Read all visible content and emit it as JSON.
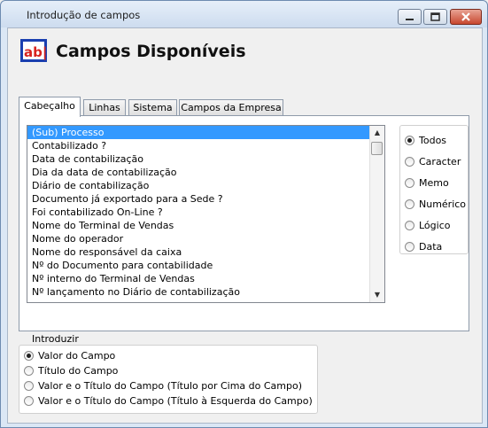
{
  "window": {
    "title": "Introdução de campos"
  },
  "header": {
    "logo_text": "ab|",
    "title": "Campos Disponíveis"
  },
  "tabs": [
    {
      "label": "Cabeçalho",
      "active": true
    },
    {
      "label": "Linhas",
      "active": false
    },
    {
      "label": "Sistema",
      "active": false
    },
    {
      "label": "Campos da Empresa",
      "active": false
    }
  ],
  "fields_list": {
    "items": [
      "(Sub) Processo",
      "Contabilizado ?",
      "Data de contabilização",
      "Dia da data de contabilização",
      "Diário de contabilização",
      "Documento já exportado para a Sede ?",
      "Foi contabilizado On-Line ?",
      "Nome do Terminal de Vendas",
      "Nome do operador",
      "Nome do responsável da caixa",
      "Nº do Documento para contabilidade",
      "Nº interno do Terminal de Vendas",
      "Nº lançamento no Diário de contabilização"
    ],
    "selected_index": 0
  },
  "type_filter": {
    "options": [
      "Todos",
      "Caracter",
      "Memo",
      "Numérico",
      "Lógico",
      "Data"
    ],
    "selected_index": 0
  },
  "introduzir": {
    "label": "Introduzir",
    "options": [
      "Valor do Campo",
      "Título do Campo",
      "Valor e o Título do Campo (Título por Cima do Campo)",
      "Valor e o Título do Campo (Título à Esquerda do Campo)"
    ],
    "selected_index": 0
  },
  "colors": {
    "selection": "#3399ff",
    "logo_blue": "#1a3fb0",
    "logo_red": "#d8231f"
  }
}
